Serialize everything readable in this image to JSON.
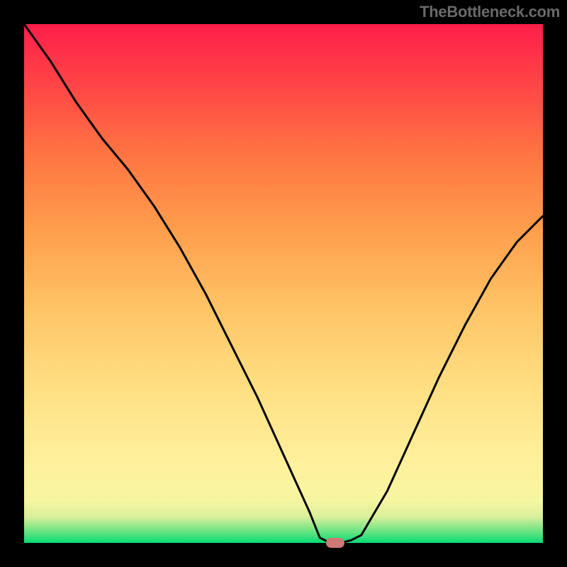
{
  "watermark": "TheBottleneck.com",
  "marker_color": "#d07874",
  "chart_data": {
    "type": "line",
    "title": "",
    "xlabel": "",
    "ylabel": "",
    "xlim": [
      0,
      100
    ],
    "ylim": [
      0,
      100
    ],
    "x": [
      0,
      5,
      10,
      15,
      20,
      25,
      30,
      35,
      40,
      45,
      50,
      55,
      57,
      59,
      61,
      63,
      65,
      70,
      75,
      80,
      85,
      90,
      95,
      100
    ],
    "values": [
      100,
      93,
      85,
      78,
      72,
      65,
      57,
      48,
      38,
      28,
      17,
      6,
      1,
      0,
      0,
      0.5,
      1.5,
      10,
      21,
      32,
      42,
      51,
      58,
      63
    ],
    "gradient_stops": [
      {
        "offset": 0.0,
        "color": "#06db74"
      },
      {
        "offset": 0.02,
        "color": "#60e380"
      },
      {
        "offset": 0.05,
        "color": "#d9ef9a"
      },
      {
        "offset": 0.08,
        "color": "#f6f5a1"
      },
      {
        "offset": 0.15,
        "color": "#fff19d"
      },
      {
        "offset": 0.3,
        "color": "#ffdf83"
      },
      {
        "offset": 0.45,
        "color": "#ffc466"
      },
      {
        "offset": 0.6,
        "color": "#ff9f4d"
      },
      {
        "offset": 0.75,
        "color": "#ff7442"
      },
      {
        "offset": 0.88,
        "color": "#ff4646"
      },
      {
        "offset": 1.0,
        "color": "#ff1e4a"
      }
    ],
    "marker": {
      "x": 60,
      "y": 0
    }
  }
}
